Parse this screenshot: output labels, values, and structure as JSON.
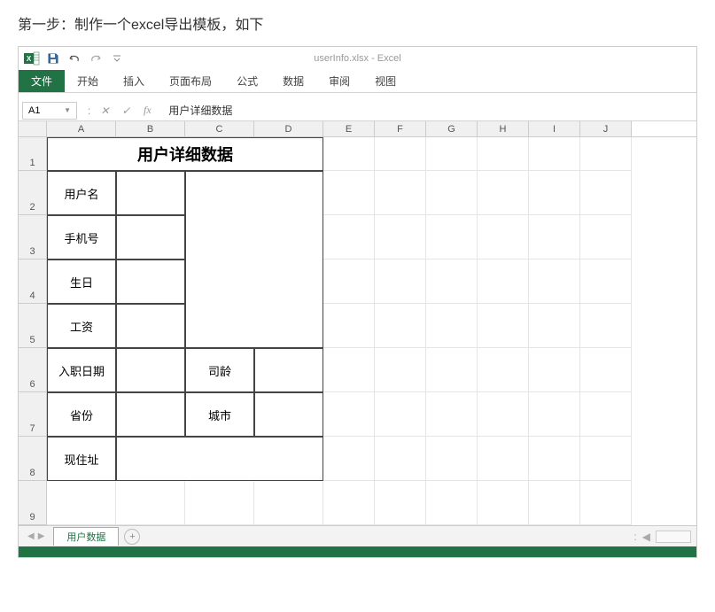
{
  "caption": "第一步：制作一个excel导出模板，如下",
  "titleFile": "userInfo.xlsx - Excel",
  "ribbon": {
    "file": "文件",
    "tabs": [
      "开始",
      "插入",
      "页面布局",
      "公式",
      "数据",
      "审阅",
      "视图"
    ]
  },
  "nameBox": "A1",
  "formula": "用户详细数据",
  "columns": [
    "A",
    "B",
    "C",
    "D",
    "E",
    "F",
    "G",
    "H",
    "I",
    "J"
  ],
  "colWidths": {
    "A": 78,
    "B": 78,
    "C": 78,
    "D": 78,
    "E": 58,
    "F": 58,
    "G": 58,
    "H": 58,
    "I": 58,
    "J": 58
  },
  "rows": [
    "1",
    "2",
    "3",
    "4",
    "5",
    "6",
    "7",
    "8",
    "9"
  ],
  "rowHeights": {
    "1": 38,
    "2": 50,
    "3": 50,
    "4": 50,
    "5": 50,
    "6": 50,
    "7": 50,
    "8": 50,
    "9": 50
  },
  "cells": {
    "title": "用户详细数据",
    "username": "用户名",
    "phone": "手机号",
    "birthday": "生日",
    "salary": "工资",
    "hireDate": "入职日期",
    "tenure": "司龄",
    "province": "省份",
    "city": "城市",
    "address": "现住址"
  },
  "sheetTab": "用户数据"
}
